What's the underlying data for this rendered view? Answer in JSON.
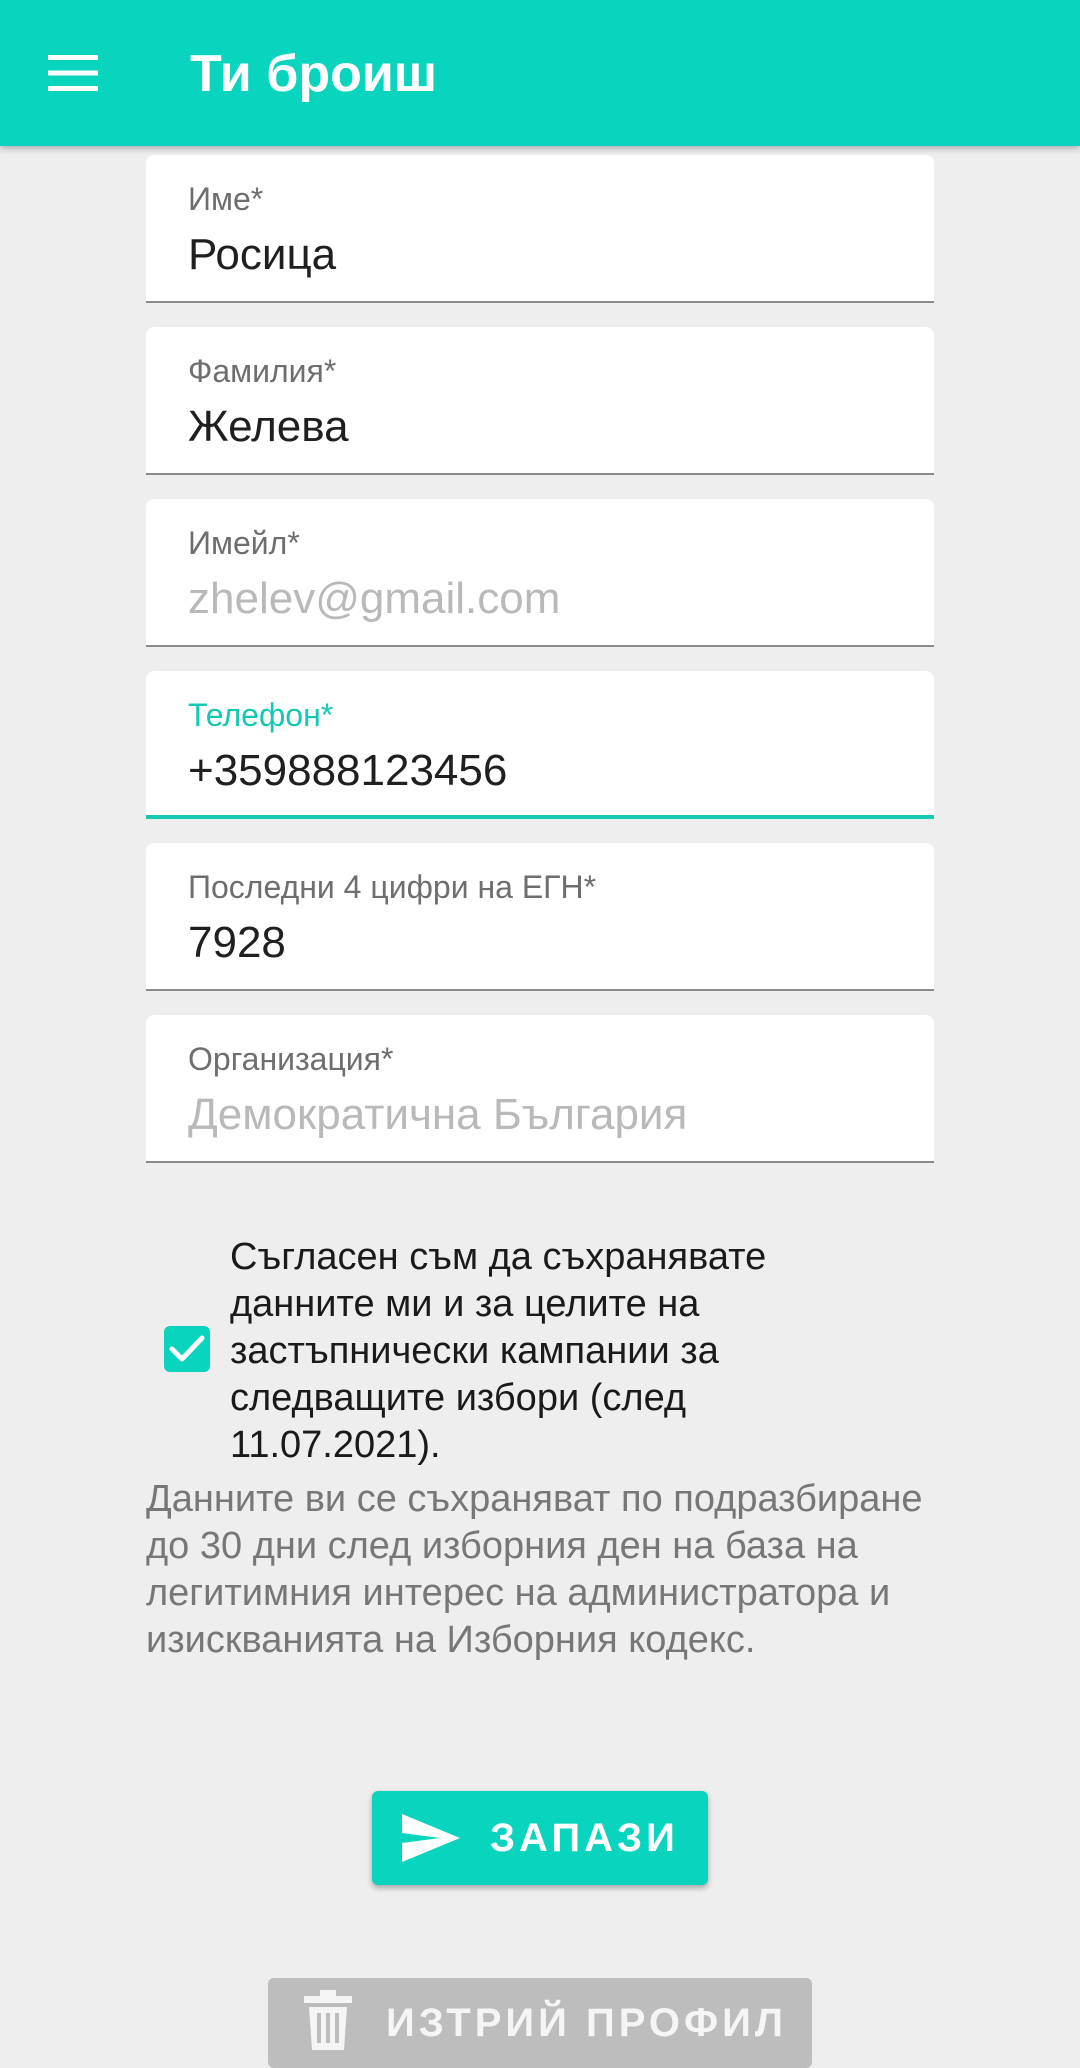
{
  "app_bar": {
    "title": "Ти броиш",
    "menu_icon": "menu-icon",
    "background_color": "#09d4bd"
  },
  "form": {
    "fields": [
      {
        "label": "Име*",
        "value": "Росица",
        "state": "normal"
      },
      {
        "label": "Фамилия*",
        "value": "Желева",
        "state": "normal"
      },
      {
        "label": "Имейл*",
        "value": "zhelev@gmail.com",
        "state": "disabled"
      },
      {
        "label": "Телефон*",
        "value": "+359888123456",
        "state": "focused"
      },
      {
        "label": "Последни 4 цифри на ЕГН*",
        "value": "7928",
        "state": "normal"
      },
      {
        "label": "Организация*",
        "value": "Демократична България",
        "state": "disabled"
      }
    ]
  },
  "consent": {
    "checked": true,
    "text": "Съгласен съм да съхранявате данните ми и за целите на застъпнически кампании за следващите избори (след 11.07.2021).",
    "note": "Данните ви се съхраняват по подразбиране до 30 дни след изборния ден на база на легитимния интерес на администратора и изискванията на Изборния кодекс."
  },
  "actions": {
    "save_label": "ЗАПАЗИ",
    "save_icon": "send-icon",
    "delete_label": "ИЗТРИЙ ПРОФИЛ",
    "delete_icon": "trash-icon"
  },
  "colors": {
    "accent": "#09d4bd",
    "page_background": "#eeeeee",
    "delete_button": "#bdbdbd"
  }
}
